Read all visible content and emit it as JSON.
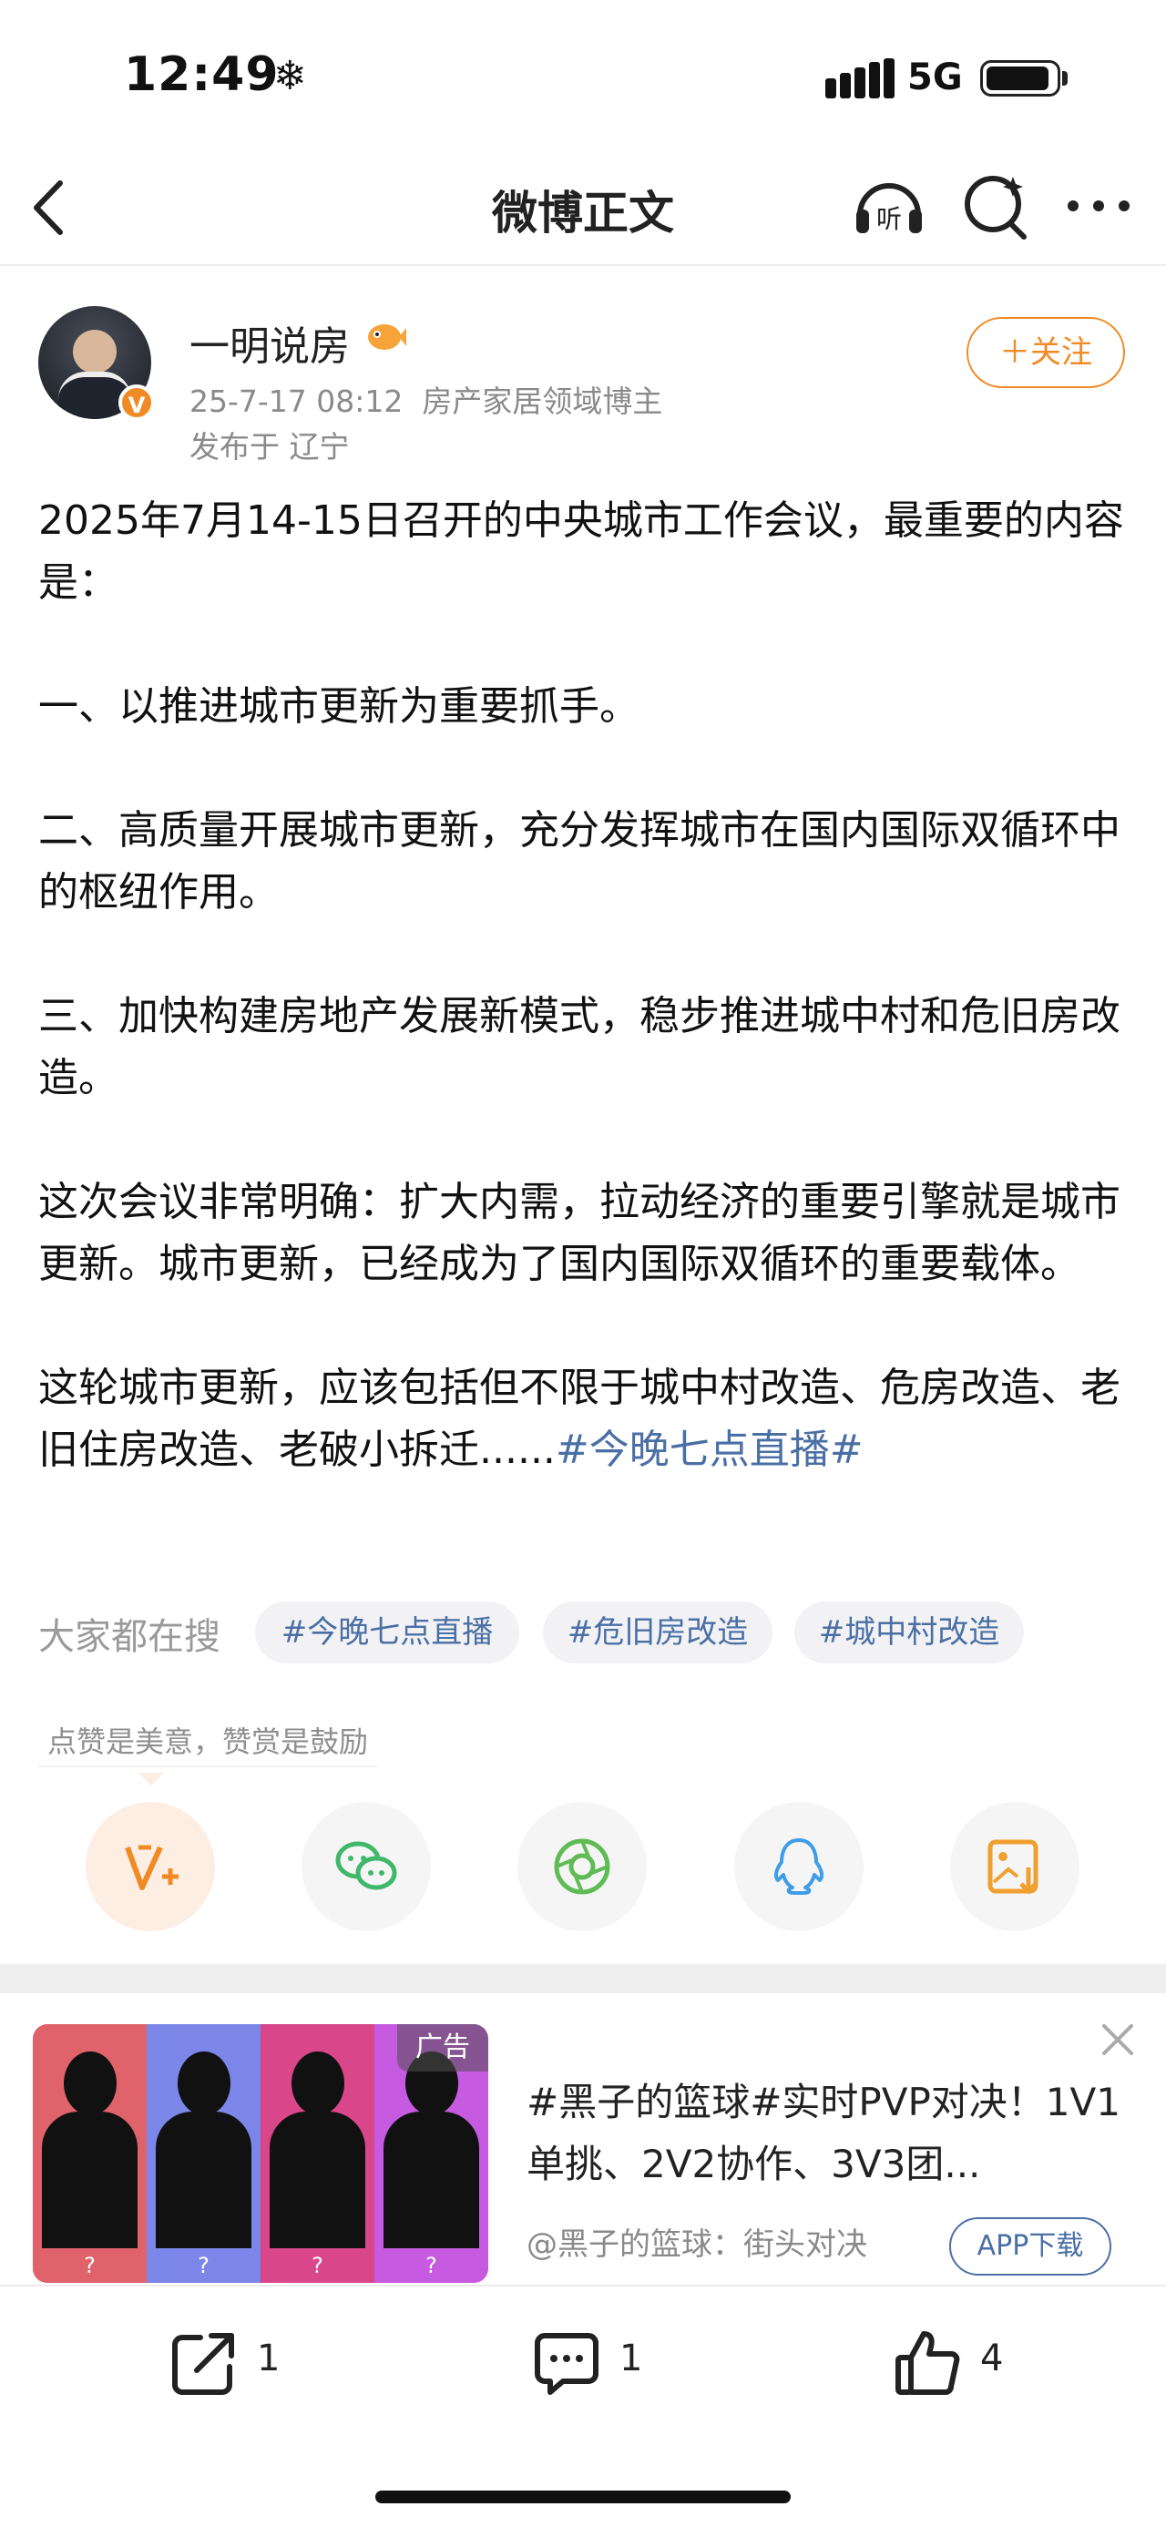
{
  "status_bar": {
    "time": "12:49",
    "network": "5G"
  },
  "nav": {
    "title": "微博正文"
  },
  "author": {
    "name": "一明说房",
    "date": "25-7-17 08:12",
    "category": "房产家居领域博主",
    "location": "发布于 辽宁",
    "verified_badge": "V"
  },
  "follow_label": "＋关注",
  "post": {
    "paragraphs": [
      "2025年7月14-15日召开的中央城市工作会议，最重要的内容是：",
      "一、以推进城市更新为重要抓手。",
      "二、高质量开展城市更新，充分发挥城市在国内国际双循环中的枢纽作用。",
      "三、加快构建房地产发展新模式，稳步推进城中村和危旧房改造。",
      "这次会议非常明确：扩大内需，拉动经济的重要引擎就是城市更新。城市更新，已经成为了国内国际双循环的重要载体。"
    ],
    "last_text": "这轮城市更新，应该包括但不限于城中村改造、危房改造、老旧住房改造、老破小拆迁......",
    "last_tag": "#今晚七点直播#"
  },
  "search": {
    "label": "大家都在搜",
    "chips": [
      "#今晚七点直播",
      "#危旧房改造",
      "#城中村改造"
    ]
  },
  "reward_tip": "点赞是美意，赞赏是鼓励",
  "share_icons": [
    "reward-icon",
    "wechat-icon",
    "moments-icon",
    "qq-icon",
    "save-image-icon"
  ],
  "ad": {
    "badge": "广告",
    "title": "#黑子的篮球#实时PVP对决！1V1单挑、2V2协作、3V3团...",
    "source": "@黑子的篮球：街头对决",
    "button": "APP下载",
    "panel_marks": [
      "?",
      "?",
      "?",
      "?"
    ],
    "panel_colors": [
      "#e0626a",
      "#7b86e8",
      "#d9478a",
      "#c65ae0"
    ]
  },
  "actions": {
    "repost_count": "1",
    "comment_count": "1",
    "like_count": "4"
  },
  "colors": {
    "accent_orange": "#f08a24",
    "link_blue": "#4a6fa5"
  }
}
